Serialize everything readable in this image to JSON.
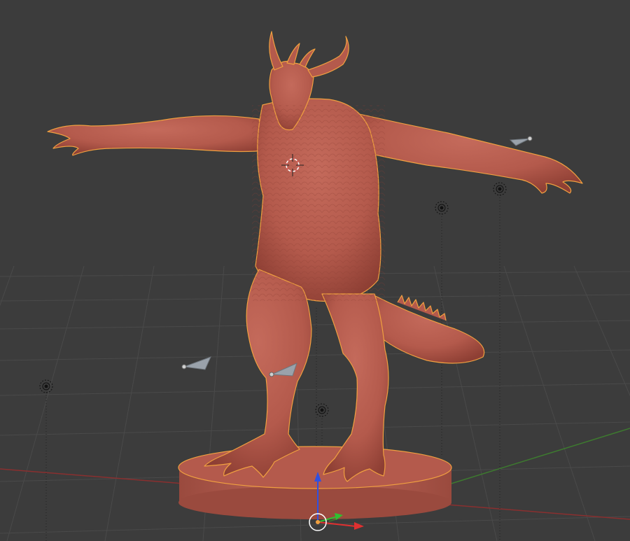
{
  "viewport": {
    "background_color": "#3c3c3c",
    "grid_line_color": "#4a4a4a",
    "x_axis_color": "#8a2f2f",
    "y_axis_color": "#3d7a2f",
    "model_color": "#b45a4c",
    "model_shadow_color": "#8e3f34",
    "selection_outline_color": "#f0a040",
    "lamp_icons": [
      "lamp-icon",
      "lamp-icon",
      "lamp-icon",
      "lamp-icon"
    ],
    "camera_icons": [
      "camera-icon",
      "camera-icon",
      "camera-icon"
    ],
    "gizmo": {
      "z_color": "#3050e0",
      "y_color": "#30c030",
      "x_color": "#e03030"
    }
  }
}
